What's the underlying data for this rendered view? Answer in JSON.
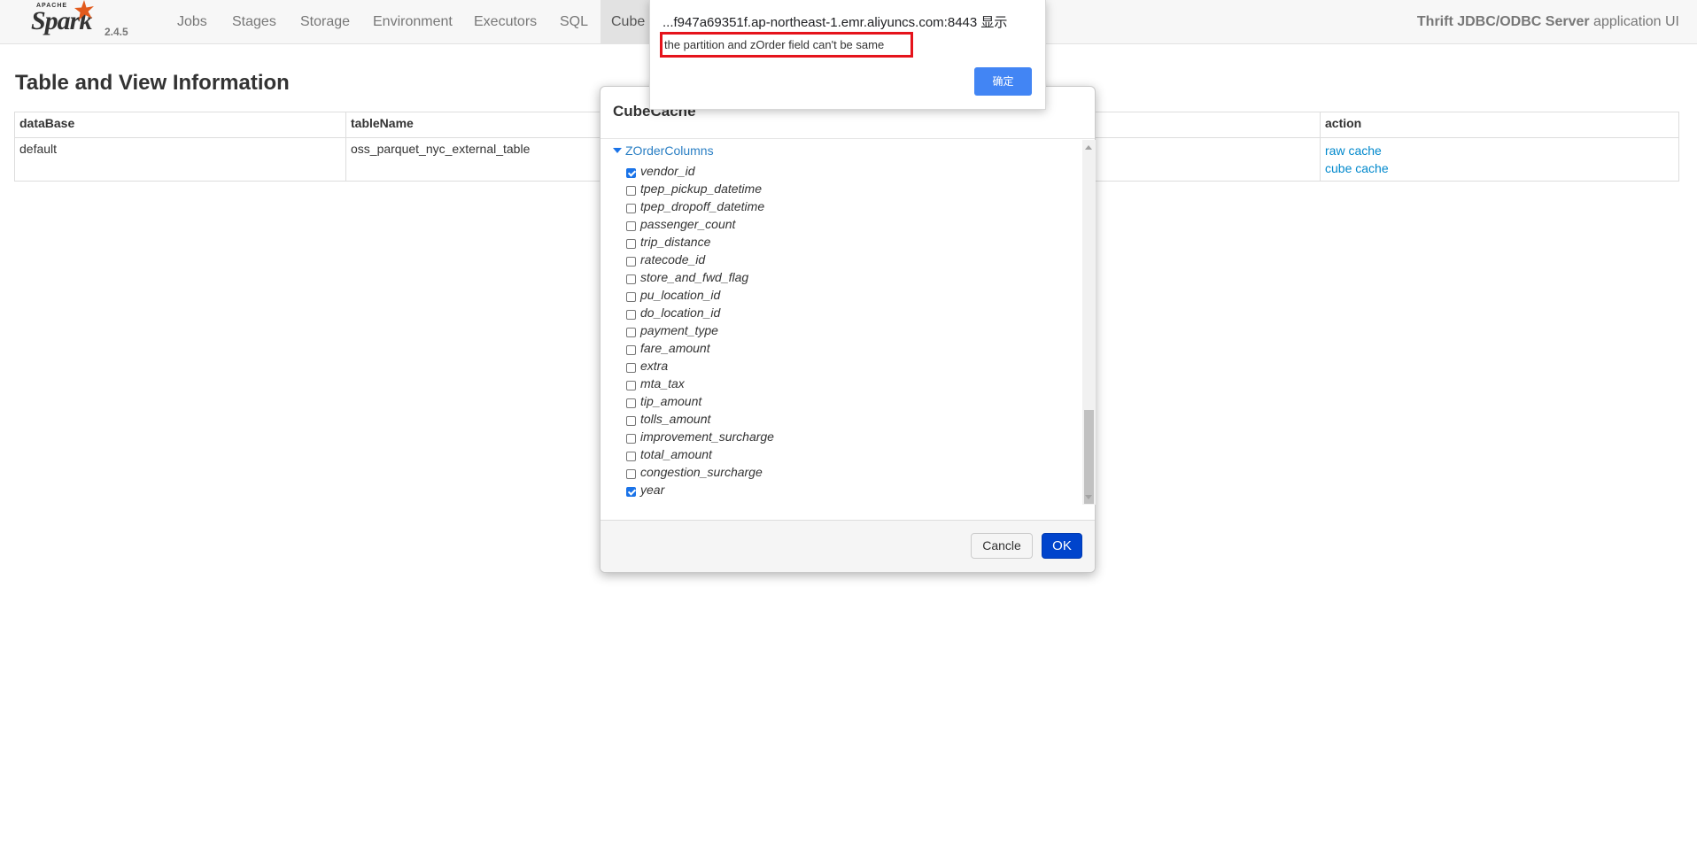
{
  "navbar": {
    "brand_apache": "APACHE",
    "brand_name": "Spark",
    "version": "2.4.5",
    "tabs": [
      {
        "label": "Jobs"
      },
      {
        "label": "Stages"
      },
      {
        "label": "Storage"
      },
      {
        "label": "Environment"
      },
      {
        "label": "Executors"
      },
      {
        "label": "SQL"
      },
      {
        "label": "Cube"
      }
    ],
    "app_name": "Thrift JDBC/ODBC Server",
    "app_suffix": " application UI"
  },
  "page": {
    "title": "Table and View Information",
    "table": {
      "headers": [
        "dataBase",
        "tableName",
        "action"
      ],
      "rows": [
        {
          "database": "default",
          "table_name": "oss_parquet_nyc_external_table",
          "actions": [
            "raw cache",
            "cube cache"
          ]
        }
      ]
    }
  },
  "modal": {
    "title": "CubeCache",
    "group_label": "ZOrderColumns",
    "columns": [
      {
        "name": "vendor_id",
        "checked": true
      },
      {
        "name": "tpep_pickup_datetime",
        "checked": false
      },
      {
        "name": "tpep_dropoff_datetime",
        "checked": false
      },
      {
        "name": "passenger_count",
        "checked": false
      },
      {
        "name": "trip_distance",
        "checked": false
      },
      {
        "name": "ratecode_id",
        "checked": false
      },
      {
        "name": "store_and_fwd_flag",
        "checked": false
      },
      {
        "name": "pu_location_id",
        "checked": false
      },
      {
        "name": "do_location_id",
        "checked": false
      },
      {
        "name": "payment_type",
        "checked": false
      },
      {
        "name": "fare_amount",
        "checked": false
      },
      {
        "name": "extra",
        "checked": false
      },
      {
        "name": "mta_tax",
        "checked": false
      },
      {
        "name": "tip_amount",
        "checked": false
      },
      {
        "name": "tolls_amount",
        "checked": false
      },
      {
        "name": "improvement_surcharge",
        "checked": false
      },
      {
        "name": "total_amount",
        "checked": false
      },
      {
        "name": "congestion_surcharge",
        "checked": false
      },
      {
        "name": "year",
        "checked": true
      }
    ],
    "cancel_label": "Cancle",
    "ok_label": "OK"
  },
  "alert": {
    "origin": "...f947a69351f.ap-northeast-1.emr.aliyuncs.com:8443 显示",
    "message": "the partition and zOrder field can't be same",
    "confirm_label": "确定"
  },
  "colors": {
    "accent": "#0088cc",
    "ok_button": "#0044cc",
    "alert_button": "#4285f4",
    "highlight_box": "#e5131b"
  },
  "icons": {
    "logo": "spark-star-icon",
    "tree_toggle": "caret-down-icon",
    "checkbox": "checkbox-icon"
  }
}
